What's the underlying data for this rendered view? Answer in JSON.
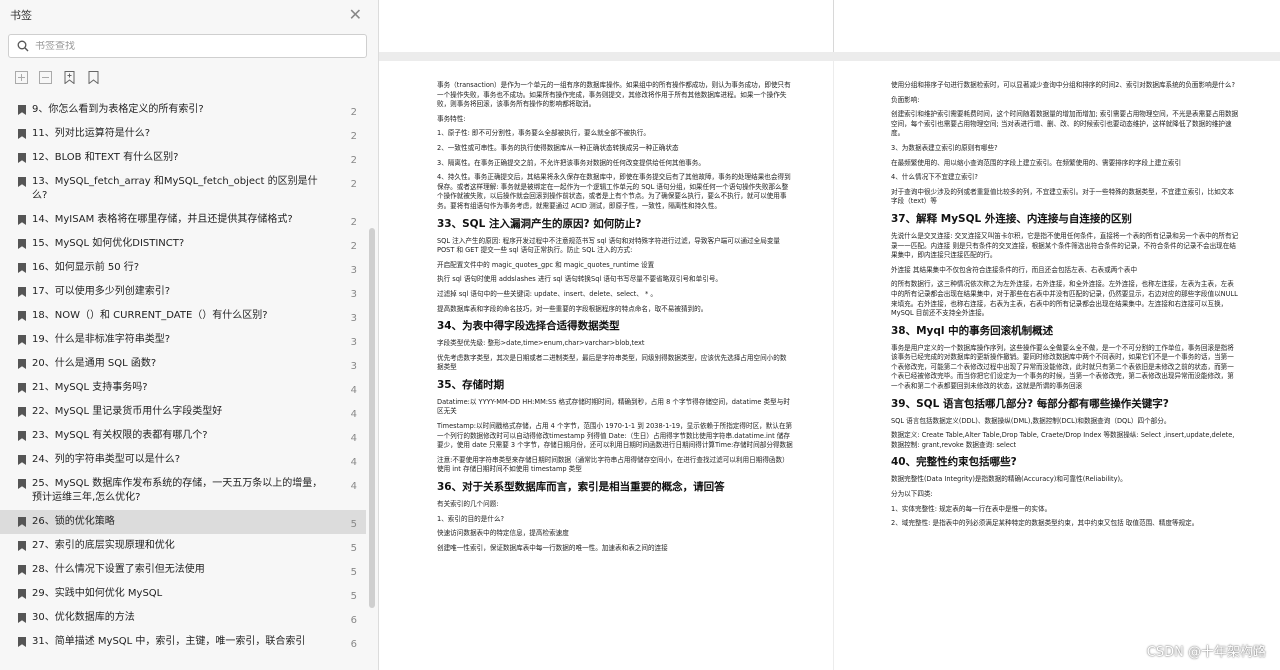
{
  "sidebar": {
    "title": "书签",
    "search_placeholder": "书签查找",
    "items": [
      {
        "label": "9、你怎么看到为表格定义的所有索引?",
        "page": "2"
      },
      {
        "label": "11、列对比运算符是什么?",
        "page": "2"
      },
      {
        "label": "12、BLOB 和TEXT 有什么区别?",
        "page": "2"
      },
      {
        "label": "13、MySQL_fetch_array 和MySQL_fetch_object 的区别是什么?",
        "page": "2"
      },
      {
        "label": "14、MyISAM 表格将在哪里存储，并且还提供其存储格式?",
        "page": "2"
      },
      {
        "label": "15、MySQL 如何优化DISTINCT?",
        "page": "2"
      },
      {
        "label": "16、如何显示前 50 行?",
        "page": "3"
      },
      {
        "label": "17、可以使用多少列创建索引?",
        "page": "3"
      },
      {
        "label": "18、NOW（）和 CURRENT_DATE（）有什么区别?",
        "page": "3"
      },
      {
        "label": "19、什么是非标准字符串类型?",
        "page": "3"
      },
      {
        "label": "20、什么是通用 SQL 函数?",
        "page": "3"
      },
      {
        "label": "21、MySQL 支持事务吗?",
        "page": "4"
      },
      {
        "label": "22、MySQL 里记录货币用什么字段类型好",
        "page": "4"
      },
      {
        "label": "23、MySQL 有关权限的表都有哪几个?",
        "page": "4"
      },
      {
        "label": "24、列的字符串类型可以是什么?",
        "page": "4"
      },
      {
        "label": "25、MySQL 数据库作发布系统的存储，一天五万条以上的增量， 预计运维三年,怎么优化?",
        "page": "4"
      },
      {
        "label": "26、锁的优化策略",
        "page": "5"
      },
      {
        "label": "27、索引的底层实现原理和优化",
        "page": "5"
      },
      {
        "label": "28、什么情况下设置了索引但无法使用",
        "page": "5"
      },
      {
        "label": "29、实践中如何优化 MySQL",
        "page": "5"
      },
      {
        "label": "30、优化数据库的方法",
        "page": "6"
      },
      {
        "label": "31、简单描述 MySQL 中，索引，主键，唯一索引，联合索引",
        "page": "6"
      }
    ]
  },
  "left_page": [
    {
      "t": "p",
      "text": "事务（transaction）是作为一个单元的一组有序的数据库操作。如果组中的所有操作都成功，则认为事务成功，即使只有一个操作失败，事务也不成功。如果所有操作完成，事务则提交，其修改将作用于所有其他数据库进程。如果一个操作失败，则事务将回滚，该事务所有操作的影响都将取消。"
    },
    {
      "t": "p",
      "text": "事务特性:"
    },
    {
      "t": "p",
      "text": "1、原子性: 即不可分割性，事务要么全部被执行，要么就全部不被执行。"
    },
    {
      "t": "p",
      "text": "2、一致性或可串性。事务的执行使得数据库从一种正确状态转换成另一种正确状态"
    },
    {
      "t": "p",
      "text": "3、隔离性。在事务正确提交之前，不允许把该事务对数据的任何改变提供给任何其他事务。"
    },
    {
      "t": "p",
      "text": "4、持久性。事务正确提交后，其结果将永久保存在数据库中，即使在事务提交后有了其他故障，事务的处理结果也会得到保存。或者这样理解: 事务就是被绑定在一起作为一个逻辑工作单元的 SQL 语句分组，如果任何一个语句操作失败那么整个操作就被失败，以后操作就会回滚到操作前状态，或者是上有个节点。为了确保要么执行，要么不执行，就可以使用事务。要将有组语句作为事务考虑，就需要通过 ACID 测试，即原子性，一致性，隔离性和持久性。"
    },
    {
      "t": "h",
      "text": "33、SQL 注入漏洞产生的原因? 如何防止?"
    },
    {
      "t": "p",
      "text": "SQL 注入产生的原因: 程序开发过程中不注意规范书写 sql 语句和对特殊字符进行过滤，导致客户端可以通过全局变量 POST 和 GET 提交一些 sql 语句正常执行。防止 SQL 注入的方式:"
    },
    {
      "t": "p",
      "text": "开启配置文件中的 magic_quotes_gpc 和 magic_quotes_runtime 设置"
    },
    {
      "t": "p",
      "text": "执行 sql 语句时使用 addslashes 进行 sql 语句转换Sql 语句书写尽量不要省略双引号和单引号。"
    },
    {
      "t": "p",
      "text": "过滤掉 sql 语句中的一些关键词: update、insert、delete、select、 * 。"
    },
    {
      "t": "p",
      "text": "提高数据库表和字段的命名技巧，对一些重要的字段根据程序的特点命名，取不易被猜到的。"
    },
    {
      "t": "h",
      "text": "34、为表中得字段选择合适得数据类型"
    },
    {
      "t": "p",
      "text": "字段类型优先级: 整形>date,time>enum,char>varchar>blob,text"
    },
    {
      "t": "p",
      "text": "优先考虑数字类型，其次是日期或者二进制类型，最后是字符串类型，同级别得数据类型，应该优先选择占用空间小的数据类型"
    },
    {
      "t": "h",
      "text": "35、存储时期"
    },
    {
      "t": "p",
      "text": "Datatime:以 YYYY-MM-DD HH:MM:SS 格式存储时期时间，精确到秒，占用 8 个字节得存储空间，datatime 类型与时区无关"
    },
    {
      "t": "p",
      "text": "Timestamp:以时间戳格式存储，占用 4 个字节，范围小 1970-1-1 到 2038-1-19，显示依赖于所指定得时区，默认在第一个列行的数据修改时可以自动得修改timestamp 列得值 Date:（生日）占用得字节数比使用字符串.datatime.int 储存要少，使用 date 只需要 3 个字节，存储日期月份，还可以利用日期时间函数进行日期间得计算Time:存储时间部分得数据"
    },
    {
      "t": "p",
      "text": "注意:不要使用字符串类型来存储日期时间数据（通常比字符串占用得储存空间小，在进行查找过滤可以利用日期得函数）使用 int 存储日期时间不如使用 timestamp 类型"
    },
    {
      "t": "h",
      "text": "36、对于关系型数据库而言，索引是相当重要的概念，请回答"
    },
    {
      "t": "p",
      "text": "有关索引的几个问题:"
    },
    {
      "t": "p",
      "text": "1、索引的目的是什么?"
    },
    {
      "t": "p",
      "text": "快速访问数据表中的特定信息，提高检索速度"
    },
    {
      "t": "p",
      "text": "创建唯一性索引，保证数据库表中每一行数据的唯一性。加速表和表之间的连接"
    }
  ],
  "right_page": [
    {
      "t": "p",
      "text": "使用分组和排序子句进行数据检索时，可以显著减少查询中分组和排序的时间2、索引对数据库系统的负面影响是什么?"
    },
    {
      "t": "p",
      "text": "负面影响:"
    },
    {
      "t": "p",
      "text": "创建索引和维护索引需要耗费时间，这个时间随着数据量的增加而增加; 索引需要占用物理空间，不光是表需要占用数据空间，每个索引也需要占用物理空间; 当对表进行增、删、改、的时候索引也要动态维护，这样就降低了数据的维护速度。"
    },
    {
      "t": "p",
      "text": "3、为数据表建立索引的原则有哪些?"
    },
    {
      "t": "p",
      "text": "在最频繁使用的、用以缩小查询范围的字段上建立索引。在频繁使用的、需要排序的字段上建立索引"
    },
    {
      "t": "p",
      "text": "4、什么情况下不宜建立索引?"
    },
    {
      "t": "p",
      "text": "对于查询中很少涉及的列或者重复值比较多的列，不宜建立索引。对于一些特殊的数据类型，不宜建立索引，比如文本字段（text）等"
    },
    {
      "t": "h",
      "text": "37、解释 MySQL 外连接、内连接与自连接的区别"
    },
    {
      "t": "p",
      "text": "先说什么是交叉连接: 交叉连接又叫笛卡尔积，它是指不使用任何条件，直接将一个表的所有记录和另一个表中的所有记录一一匹配。内连接 则是只有条件的交叉连接，根据某个条件筛选出符合条件的记录，不符合条件的记录不会出现在结果集中，即内连接只连接匹配的行。"
    },
    {
      "t": "p",
      "text": "外连接 其结果集中不仅包含符合连接条件的行，而且还会包括左表、右表或两个表中"
    },
    {
      "t": "p",
      "text": "的所有数据行，这三种情况依次称之为左外连接，右外连接，和全外连接。左外连接，也称左连接，左表为主表，左表中的所有记录都会出现在结果集中，对于那些在右表中并没有匹配的记录，仍然要显示，右边对应的那些字段值以NULL 来填充。右外连接，也称右连接，右表为主表，右表中的所有记录都会出现在结果集中。左连接和右连接可以互换，MySQL 目前还不支持全外连接。"
    },
    {
      "t": "h",
      "text": "38、Myql 中的事务回滚机制概述"
    },
    {
      "t": "p",
      "text": "事务是用户定义的一个数据库操作序列，这些操作要么全做要么全不做，是一个不可分割的工作单位，事务回滚是指将该事务已经完成的对数据库的更新操作撤销。要同时修改数据库中两个不同表时，如果它们不是一个事务的话，当第一个表修改完，可能第二个表修改过程中出现了异常而没能修改，此时就只有第二个表依旧是未修改之前的状态，而第一个表已经被修改完毕。而当你把它们设定为一个事务的时候，当第一个表修改完，第二表修改出现异常而没能修改，第一个表和第二个表都要回到未修改的状态，这就是所谓的事务回滚"
    },
    {
      "t": "h",
      "text": "39、SQL 语言包括哪几部分? 每部分都有哪些操作关键字?"
    },
    {
      "t": "p",
      "text": "SQL 语言包括数据定义(DDL)、数据操纵(DML),数据控制(DCL)和数据查询（DQL）四个部分。"
    },
    {
      "t": "p",
      "text": "数据定义: Create Table,Alter Table,Drop Table, Craete/Drop Index 等数据操纵: Select ,insert,update,delete,数据控制: grant,revoke 数据查询: select"
    },
    {
      "t": "h",
      "text": "40、完整性约束包括哪些?"
    },
    {
      "t": "p",
      "text": "数据完整性(Data Integrity)是指数据的精确(Accuracy)和可靠性(Reliability)。"
    },
    {
      "t": "p",
      "text": "分为以下四类:"
    },
    {
      "t": "p",
      "text": "1、实体完整性: 规定表的每一行在表中是惟一的实体。"
    },
    {
      "t": "p",
      "text": "2、域完整性: 是指表中的列必须满足某种特定的数据类型约束，其中约束又包括 取值范围、精度等规定。"
    }
  ],
  "watermark": "CSDN @十年架构路"
}
